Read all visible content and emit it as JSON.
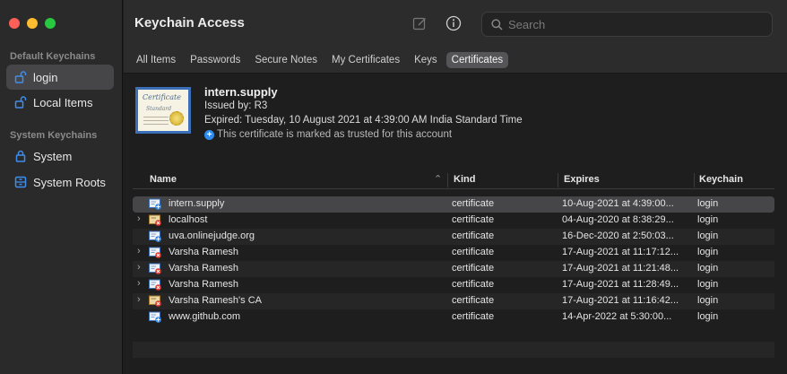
{
  "window": {
    "title": "Keychain Access"
  },
  "sidebar": {
    "sections": [
      {
        "label": "Default Keychains"
      },
      {
        "label": "System Keychains"
      }
    ],
    "items": [
      {
        "label": "login",
        "icon": "lock-open-icon",
        "selected": true
      },
      {
        "label": "Local Items",
        "icon": "lock-open-icon",
        "selected": false
      },
      {
        "label": "System",
        "icon": "lock-icon",
        "selected": false
      },
      {
        "label": "System Roots",
        "icon": "cabinet-icon",
        "selected": false
      }
    ]
  },
  "toolbar": {
    "edit_icon": "compose-icon",
    "info_icon": "info-icon",
    "search_placeholder": "Search"
  },
  "tabs": [
    {
      "label": "All Items"
    },
    {
      "label": "Passwords"
    },
    {
      "label": "Secure Notes"
    },
    {
      "label": "My Certificates"
    },
    {
      "label": "Keys"
    },
    {
      "label": "Certificates",
      "active": true
    }
  ],
  "certificate": {
    "image_text_1": "Certificate",
    "image_text_2": "Standard",
    "name": "intern.supply",
    "issued_by": "Issued by: R3",
    "expired": "Expired: Tuesday, 10 August 2021 at 4:39:00 AM India Standard Time",
    "trust_note": "This certificate is marked as trusted for this account"
  },
  "table": {
    "columns": [
      "Name",
      "Kind",
      "Expires",
      "Keychain"
    ],
    "rows": [
      {
        "name": "intern.supply",
        "kind": "certificate",
        "expires": "10-Aug-2021 at 4:39:00...",
        "keychain": "login",
        "expandable": false,
        "icon": "cert-trusted-icon"
      },
      {
        "name": "localhost",
        "kind": "certificate",
        "expires": "04-Aug-2020 at 8:38:29...",
        "keychain": "login",
        "expandable": true,
        "icon": "cert-root-invalid-icon"
      },
      {
        "name": "uva.onlinejudge.org",
        "kind": "certificate",
        "expires": "16-Dec-2020 at 2:50:03...",
        "keychain": "login",
        "expandable": false,
        "icon": "cert-trusted-icon"
      },
      {
        "name": "Varsha Ramesh",
        "kind": "certificate",
        "expires": "17-Aug-2021 at 11:17:12...",
        "keychain": "login",
        "expandable": true,
        "icon": "cert-invalid-icon"
      },
      {
        "name": "Varsha Ramesh",
        "kind": "certificate",
        "expires": "17-Aug-2021 at 11:21:48...",
        "keychain": "login",
        "expandable": true,
        "icon": "cert-invalid-icon"
      },
      {
        "name": "Varsha Ramesh",
        "kind": "certificate",
        "expires": "17-Aug-2021 at 11:28:49...",
        "keychain": "login",
        "expandable": true,
        "icon": "cert-invalid-icon"
      },
      {
        "name": "Varsha Ramesh's CA",
        "kind": "certificate",
        "expires": "17-Aug-2021 at 11:16:42...",
        "keychain": "login",
        "expandable": true,
        "icon": "cert-root-invalid-icon"
      },
      {
        "name": "www.github.com",
        "kind": "certificate",
        "expires": "14-Apr-2022 at 5:30:00...",
        "keychain": "login",
        "expandable": false,
        "icon": "cert-trusted-icon"
      }
    ]
  },
  "colors": {
    "selection": "#464649",
    "accent_blue": "#2f8df0",
    "invalid_red": "#d83b2f"
  }
}
